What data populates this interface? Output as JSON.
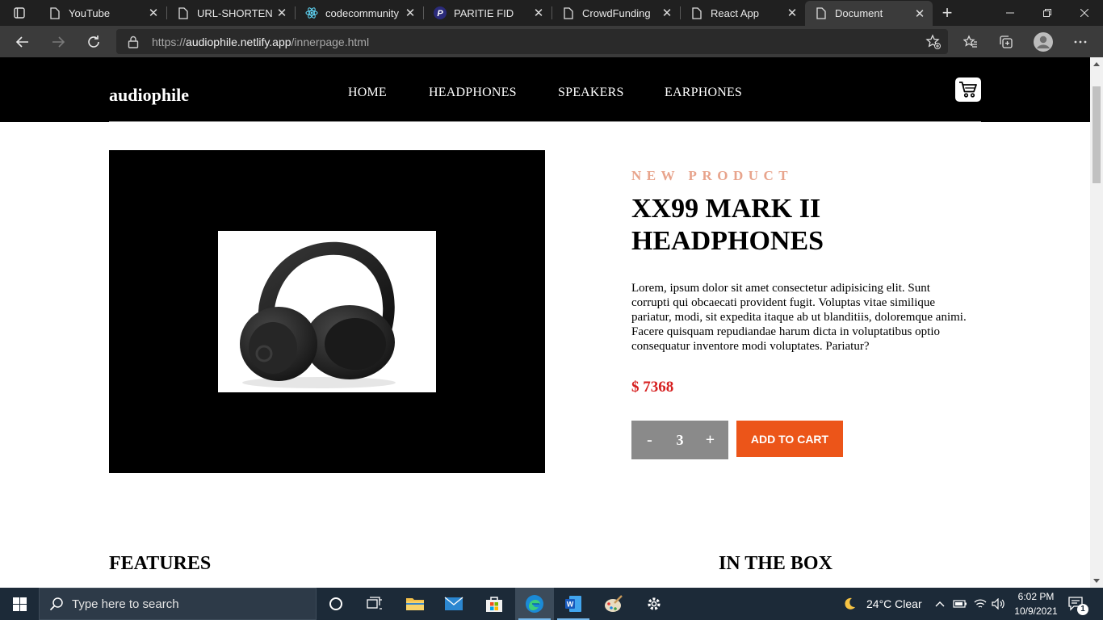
{
  "browser": {
    "tabs": [
      {
        "title": "YouTube",
        "icon": "page-icon"
      },
      {
        "title": "URL-SHORTENING",
        "icon": "page-icon"
      },
      {
        "title": "codecommunity",
        "icon": "react-icon"
      },
      {
        "title": "PARITIE FID",
        "icon": "p-logo-icon"
      },
      {
        "title": "CrowdFunding",
        "icon": "page-icon"
      },
      {
        "title": "React App",
        "icon": "page-icon"
      },
      {
        "title": "Document",
        "icon": "page-icon",
        "active": true
      }
    ],
    "address": {
      "prefix": "https://",
      "host": "audiophile.netlify.app",
      "path": "/innerpage.html"
    }
  },
  "site": {
    "logo": "audiophile",
    "nav": [
      "HOME",
      "HEADPHONES",
      "SPEAKERS",
      "EARPHONES"
    ]
  },
  "product": {
    "overline": "NEW PRODUCT",
    "title_line1": "XX99 MARK II",
    "title_line2": "HEADPHONES",
    "description": "Lorem, ipsum dolor sit amet consectetur adipisicing elit. Sunt corrupti qui obcaecati provident fugit. Voluptas vitae similique pariatur, modi, sit expedita itaque ab ut blanditiis, doloremque animi. Facere quisquam repudiandae harum dicta in voluptatibus optio consequatur inventore modi voluptates. Pariatur?",
    "price": "$ 7368",
    "quantity": "3",
    "minus": "-",
    "plus": "+",
    "add_to_cart": "ADD TO CART"
  },
  "sections": {
    "features": "FEATURES",
    "in_the_box": "IN THE BOX"
  },
  "taskbar": {
    "search_placeholder": "Type here to search",
    "weather": "24°C  Clear",
    "time": "6:02 PM",
    "date": "10/9/2021",
    "notification_count": "1"
  },
  "colors": {
    "accent_orange": "#ec5519",
    "price_red": "#d61f1f",
    "overline_peach": "#e8a48c"
  }
}
